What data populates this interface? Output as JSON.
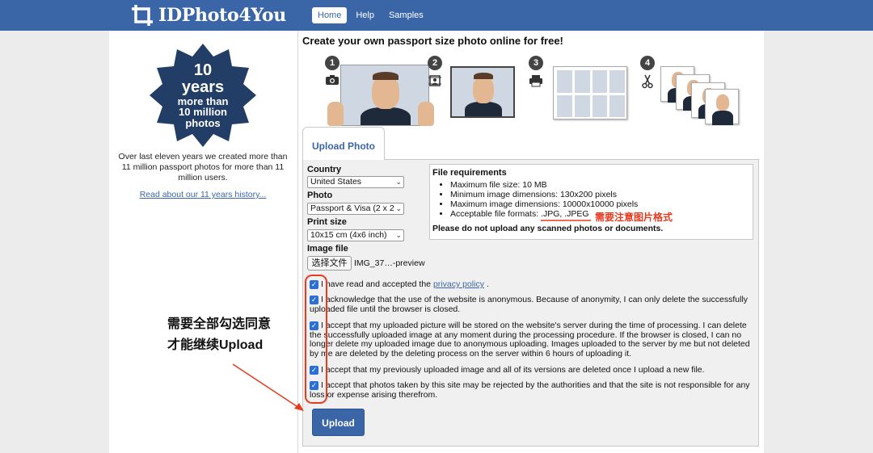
{
  "header": {
    "logo_text": "IDPhoto4You",
    "nav": [
      "Home",
      "Help",
      "Samples"
    ]
  },
  "left": {
    "badge": [
      "10",
      "years",
      "more than",
      "10 million",
      "photos"
    ],
    "description": "Over last eleven years we created more than 11 million passport photos for more than 11 million users.",
    "history_link": "Read about our 11 years history..."
  },
  "main": {
    "title": "Create your own passport size photo online for free!",
    "steps": [
      "1",
      "2",
      "3",
      "4"
    ],
    "tab_label": "Upload Photo",
    "country_label": "Country",
    "country_value": "United States",
    "photo_label": "Photo",
    "photo_value": "Passport & Visa (2 x 2",
    "print_label": "Print size",
    "print_value": "10x15 cm (4x6 inch)",
    "image_label": "Image file",
    "file_button": "选择文件",
    "file_name": "IMG_37…-preview",
    "requirements": {
      "title": "File requirements",
      "items": [
        "Maximum file size: 10 MB",
        "Minimum image dimensions: 130x200 pixels",
        "Maximum image dimensions: 10000x10000 pixels",
        "Acceptable file formats: .JPG, .JPEG"
      ],
      "warning": "Please do not upload any scanned photos or documents."
    },
    "checks": [
      {
        "pre": "I have read and accepted the ",
        "link": "privacy policy",
        "post": " ."
      },
      {
        "pre": "I acknowledge that the use of the website is anonymous. Because of anonymity, I can only delete the successfully uploaded file until the browser is closed.",
        "link": "",
        "post": ""
      },
      {
        "pre": "I accept that my uploaded picture will be stored on the website's server during the time of processing. I can delete the successfully uploaded image at any moment during the processing procedure. If the browser is closed, I can no longer delete my uploaded image due to anonymous uploading. Images uploaded to the server by me but not deleted by me are deleted by the deleting process on the server within 6 hours of uploading it.",
        "link": "",
        "post": ""
      },
      {
        "pre": "I accept that my previously uploaded image and all of its versions are deleted once I upload a new file.",
        "link": "",
        "post": ""
      },
      {
        "pre": "I accept that photos taken by this site may be rejected by the authorities and that the site is not responsible for any loss or expense arising therefrom.",
        "link": "",
        "post": ""
      }
    ],
    "upload_button": "Upload"
  },
  "annotations": {
    "format_note": "需要注意图片格式",
    "check_note_1": "需要全部勾选同意",
    "check_note_2": "才能继续Upload"
  }
}
